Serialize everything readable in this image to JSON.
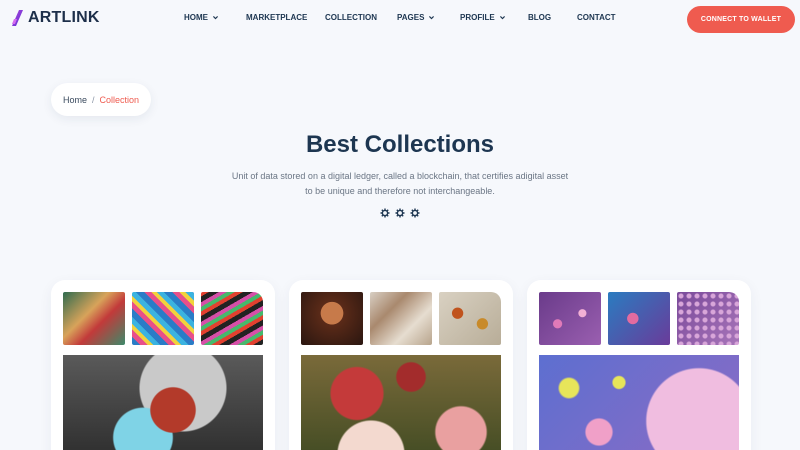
{
  "brand": {
    "name": "ARTLINK",
    "colors": {
      "accent": "#ef5b4f",
      "text": "#1d3651",
      "background": "#f6f8fc"
    }
  },
  "nav": {
    "items": [
      {
        "label": "HOME",
        "dropdown": true
      },
      {
        "label": "MARKETPLACE",
        "dropdown": false
      },
      {
        "label": "COLLECTION",
        "dropdown": false
      },
      {
        "label": "PAGES",
        "dropdown": true
      },
      {
        "label": "PROFILE",
        "dropdown": true
      },
      {
        "label": "BLOG",
        "dropdown": false
      },
      {
        "label": "CONTACT",
        "dropdown": false
      }
    ],
    "cta_label": "CONNECT TO WALLET"
  },
  "breadcrumb": {
    "home": "Home",
    "separator": "/",
    "current": "Collection"
  },
  "section": {
    "title": "Best Collections",
    "description_line1": "Unit of data stored on a digital ledger, called a blockchain, that certifies adigital asset",
    "description_line2": "to be unique and therefore not interchangeable."
  },
  "cards": [
    {
      "theme": "graffiti street art",
      "thumbnails": 3
    },
    {
      "theme": "classical paintings",
      "thumbnails": 3
    },
    {
      "theme": "colorful abstract bubbles",
      "thumbnails": 3
    }
  ]
}
